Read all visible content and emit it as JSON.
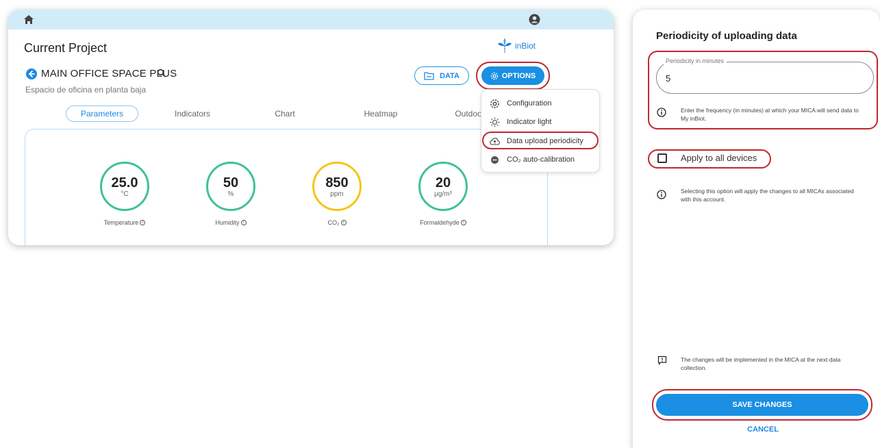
{
  "app": {
    "project_title": "Current Project",
    "logo_text": "inBiot",
    "device_name": "MAIN OFFICE SPACE PLUS",
    "device_description": "Espacio de oficina en planta baja",
    "data_button": "DATA",
    "options_button": "OPTIONS",
    "tabs": [
      {
        "label": "Parameters",
        "active": true
      },
      {
        "label": "Indicators",
        "active": false
      },
      {
        "label": "Chart",
        "active": false
      },
      {
        "label": "Heatmap",
        "active": false
      },
      {
        "label": "Outdoor",
        "active": false
      }
    ],
    "gauges": [
      {
        "value": "25.0",
        "unit": "°C",
        "label": "Temperature",
        "color": "#3ec38f"
      },
      {
        "value": "50",
        "unit": "%",
        "label": "Humidity",
        "color": "#3ec38f"
      },
      {
        "value": "850",
        "unit": "ppm",
        "label": "CO₂",
        "color": "#f5c518"
      },
      {
        "value": "20",
        "unit": "μg/m³",
        "label": "Formaldehyde",
        "color": "#3ec38f"
      }
    ],
    "options_menu": [
      {
        "label": "Configuration",
        "icon": "gear-icon"
      },
      {
        "label": "Indicator light",
        "icon": "sun-icon"
      },
      {
        "label": "Data upload periodicity",
        "icon": "cloud-upload-icon"
      },
      {
        "label": "CO₂ auto-calibration",
        "icon": "co2-badge-icon"
      }
    ]
  },
  "side": {
    "title": "Periodicity of uploading data",
    "field_label": "Periodicity in minutes",
    "field_value": "5",
    "field_hint": "Enter the frequency (in minutes) at which your MICA will send data to My inBiot.",
    "apply_label": "Apply to all devices",
    "apply_checked": false,
    "apply_hint": "Selecting this option will apply the changes to all MICAs associated with this account.",
    "notice": "The changes will be implemented in the MICA at the next data collection.",
    "save_button": "SAVE CHANGES",
    "cancel_button": "CANCEL"
  },
  "colors": {
    "accent": "#1a8fe3",
    "topbar": "#d2ebf8",
    "highlight_ring": "#c2262e"
  }
}
